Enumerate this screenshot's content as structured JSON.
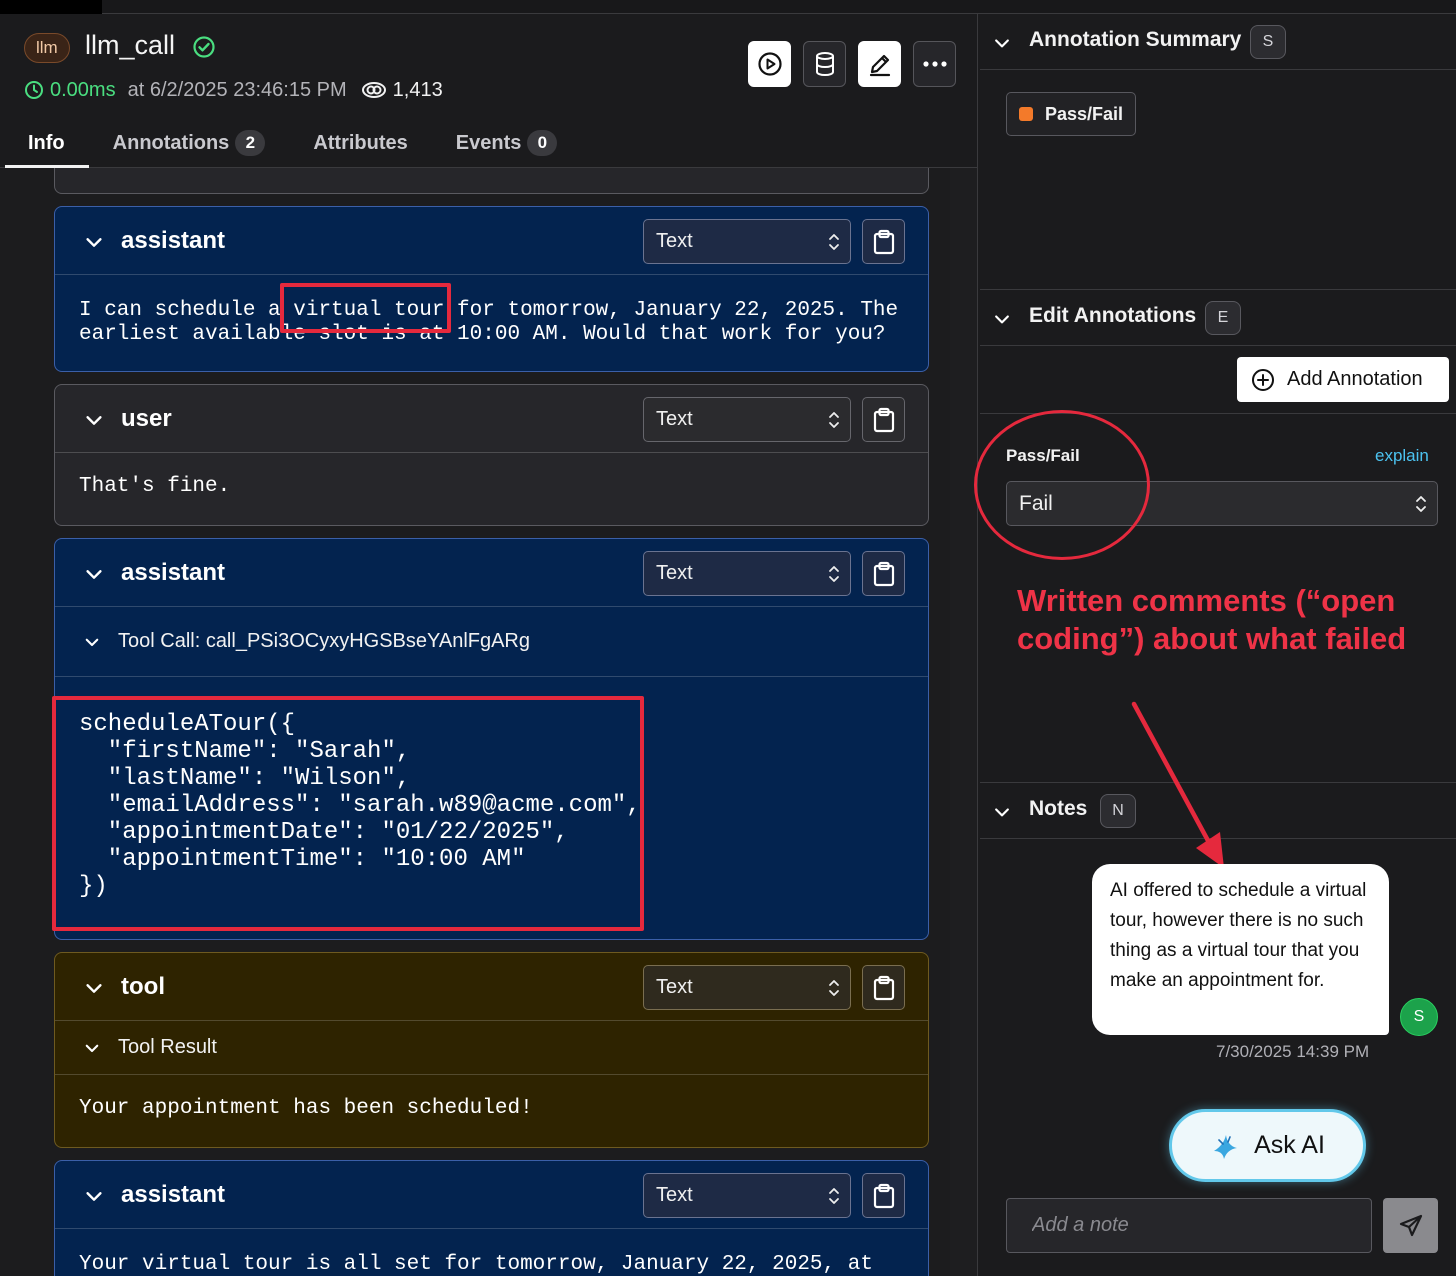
{
  "header": {
    "kind_badge": "llm",
    "span_name": "llm_call",
    "latency": "0.00ms",
    "timestamp": "at 6/2/2025 23:46:15 PM",
    "view_count": "1,413",
    "icons": [
      "play-circle-icon",
      "database-icon",
      "pencil-icon",
      "more-icon"
    ]
  },
  "tabs": [
    {
      "label": "Info",
      "count": ""
    },
    {
      "label": "Annotations",
      "count": "2"
    },
    {
      "label": "Attributes",
      "count": ""
    },
    {
      "label": "Events",
      "count": "0"
    }
  ],
  "messages": [
    {
      "role": "assistant",
      "format": "Text",
      "body": "I can schedule a virtual tour for tomorrow, January 22, 2025. The\nearliest available slot is at 10:00 AM. Would that work for you?"
    },
    {
      "role": "user",
      "format": "Text",
      "body": "That's fine."
    },
    {
      "role": "assistant",
      "format": "Text",
      "tool_call_label": "Tool Call: call_PSi3OCyxyHGSBseYAnlFgARg",
      "code": "scheduleATour({\n  \"firstName\": \"Sarah\",\n  \"lastName\": \"Wilson\",\n  \"emailAddress\": \"sarah.w89@acme.com\",\n  \"appointmentDate\": \"01/22/2025\",\n  \"appointmentTime\": \"10:00 AM\"\n})"
    },
    {
      "role": "tool",
      "format": "Text",
      "tool_result_label": "Tool Result",
      "body": "Your appointment has been scheduled!"
    },
    {
      "role": "assistant",
      "format": "Text",
      "body": "Your virtual tour is all set for tomorrow, January 22, 2025, at"
    }
  ],
  "right": {
    "annotation_summary": {
      "title": "Annotation Summary",
      "key": "S",
      "chip_label": "Pass/Fail",
      "chip_color": "#f37a2a"
    },
    "edit_annotations": {
      "title": "Edit Annotations",
      "key": "E",
      "add_label": "Add Annotation",
      "field_label": "Pass/Fail",
      "explain_label": "explain",
      "value": "Fail"
    },
    "notes": {
      "title": "Notes",
      "key": "N",
      "note_text": "AI offered to schedule a virtual tour, however there is no such thing as a virtual tour that you make an appointment for.",
      "avatar": "S",
      "note_time": "7/30/2025 14:39 PM",
      "ask_ai_label": "Ask AI",
      "input_placeholder": "Add a note"
    }
  },
  "overlay": {
    "callout_text": "Written comments (“open coding”) about what failed",
    "accent_color": "#e5293d"
  }
}
